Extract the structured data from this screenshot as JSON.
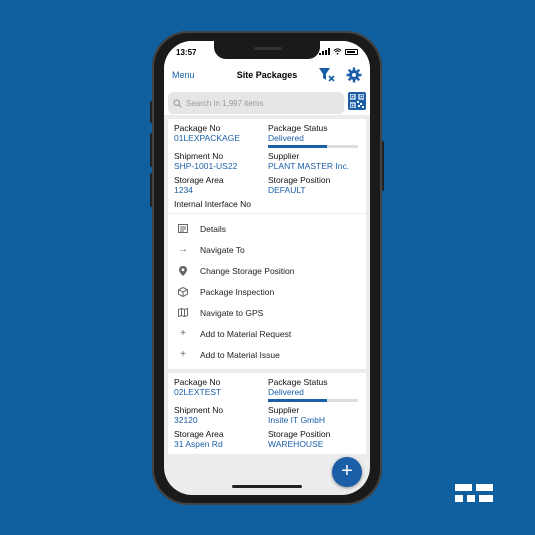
{
  "status_bar": {
    "time": "13:57"
  },
  "nav": {
    "menu_label": "Menu",
    "title": "Site Packages",
    "filter_icon": "filter-clear-icon",
    "settings_icon": "gear-icon"
  },
  "search": {
    "placeholder": "Search in 1,997 items",
    "scan_icon": "qr-code-icon"
  },
  "colors": {
    "accent": "#1a5fa8",
    "background": "#1060a0"
  },
  "packages": [
    {
      "package_no_label": "Package No",
      "package_no": "01LEXPACKAGE",
      "status_label": "Package Status",
      "status": "Delivered",
      "status_progress": 0.65,
      "shipment_label": "Shipment No",
      "shipment": "SHP-1001-US22",
      "supplier_label": "Supplier",
      "supplier": "PLANT MASTER Inc.",
      "area_label": "Storage Area",
      "area": "1234",
      "position_label": "Storage Position",
      "position": "DEFAULT",
      "interface_label": "Internal Interface No"
    },
    {
      "package_no_label": "Package No",
      "package_no": "02LEXTEST",
      "status_label": "Package Status",
      "status": "Delivered",
      "status_progress": 0.65,
      "shipment_label": "Shipment No",
      "shipment": "32120",
      "supplier_label": "Supplier",
      "supplier": "Insite IT GmbH",
      "area_label": "Storage Area",
      "area": "31 Aspen Rd",
      "position_label": "Storage Position",
      "position": "WAREHOUSE"
    }
  ],
  "actions": [
    {
      "label": "Details",
      "icon": "details-icon"
    },
    {
      "label": "Navigate To",
      "icon": "arrow-right-icon"
    },
    {
      "label": "Change Storage Position",
      "icon": "location-pin-icon"
    },
    {
      "label": "Package Inspection",
      "icon": "package-icon"
    },
    {
      "label": "Navigate to GPS",
      "icon": "map-icon"
    },
    {
      "label": "Add to Material Request",
      "icon": "plus-icon"
    },
    {
      "label": "Add to Material Issue",
      "icon": "plus-icon"
    }
  ],
  "fab": {
    "label": "+"
  }
}
